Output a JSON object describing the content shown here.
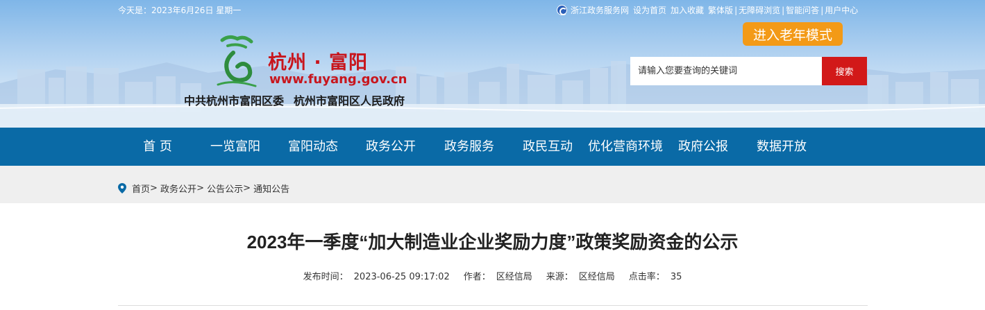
{
  "top": {
    "today": "今天是：2023年6月26日 星期一",
    "links": [
      "浙江政务服务网",
      "设为首页",
      "加入收藏",
      "繁体版",
      "无障碍浏览",
      "智能问答",
      "用户中心"
    ]
  },
  "elder_mode": "进入老年模式",
  "logo": {
    "title": "杭州 · 富阳",
    "url": "www.fuyang.gov.cn",
    "org1": "中共杭州市富阳区委",
    "org2": "杭州市富阳区人民政府"
  },
  "search": {
    "placeholder": "请输入您要查询的关键词",
    "button": "搜索"
  },
  "nav": [
    "首 页",
    "一览富阳",
    "富阳动态",
    "政务公开",
    "政务服务",
    "政民互动",
    "优化营商环境",
    "政府公报",
    "数据开放"
  ],
  "nav_active": "政务公开",
  "breadcrumb": [
    "首页",
    "政务公开",
    "公告公示",
    "通知公告"
  ],
  "article": {
    "title": "2023年一季度“加大制造业企业奖励力度”政策奖励资金的公示",
    "publish_label": "发布时间：",
    "publish_time": "2023-06-25  09:17:02",
    "author_label": "作者：",
    "author": "区经信局",
    "source_label": "来源：",
    "source": "区经信局",
    "hits_label": "点击率：",
    "hits": "35"
  },
  "colors": {
    "nav": "#0a6aa6",
    "search_button": "#d21919",
    "elder_button": "#f39a17",
    "logo_red": "#c8161d"
  }
}
